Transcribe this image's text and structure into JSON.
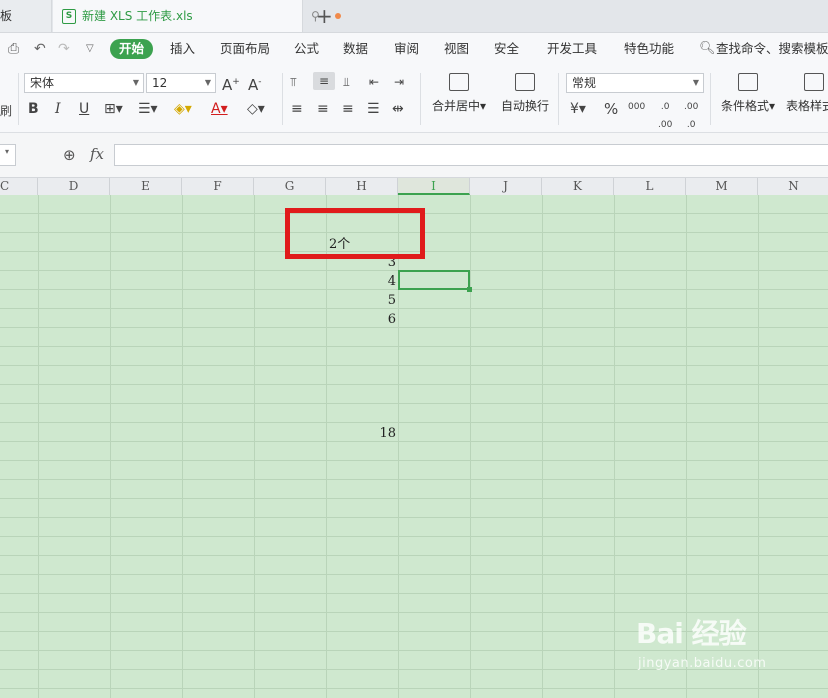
{
  "tabs": [
    {
      "label": "模板"
    },
    {
      "label": "新建 XLS 工作表.xls",
      "active": true
    }
  ],
  "menu": {
    "items": [
      "开始",
      "插入",
      "页面布局",
      "公式",
      "数据",
      "审阅",
      "视图",
      "安全",
      "开发工具",
      "特色功能"
    ],
    "search_label": "查找命令、搜索模板"
  },
  "toolbar": {
    "font_name": "宋体",
    "font_size": "12",
    "merge_label": "合并居中",
    "wrap_label": "自动换行",
    "number_format": "常规",
    "cond_format_label": "条件格式",
    "table_style_label": "表格样式",
    "increase_font": "A⁺",
    "decrease_font": "A⁻"
  },
  "formula_bar": {
    "fx": "fx",
    "value": ""
  },
  "columns": [
    "C",
    "D",
    "E",
    "F",
    "G",
    "H",
    "I",
    "J",
    "K",
    "L",
    "M",
    "N"
  ],
  "selected_column": "I",
  "cells": [
    {
      "row": 3,
      "value": "3"
    },
    {
      "row": 4,
      "value": "4"
    },
    {
      "row": 5,
      "value": "5"
    },
    {
      "row": 6,
      "value": "6"
    },
    {
      "row": 12,
      "value": "18"
    }
  ],
  "annotation": {
    "text": "2个",
    "color": "#e01b1b"
  },
  "watermark": {
    "logo": "Bai 经验",
    "sub": "jingyan.baidu.com"
  },
  "colors": {
    "accent": "#3ca24f",
    "sheet_bg": "#cfe8cf",
    "highlight": "#e01b1b"
  }
}
